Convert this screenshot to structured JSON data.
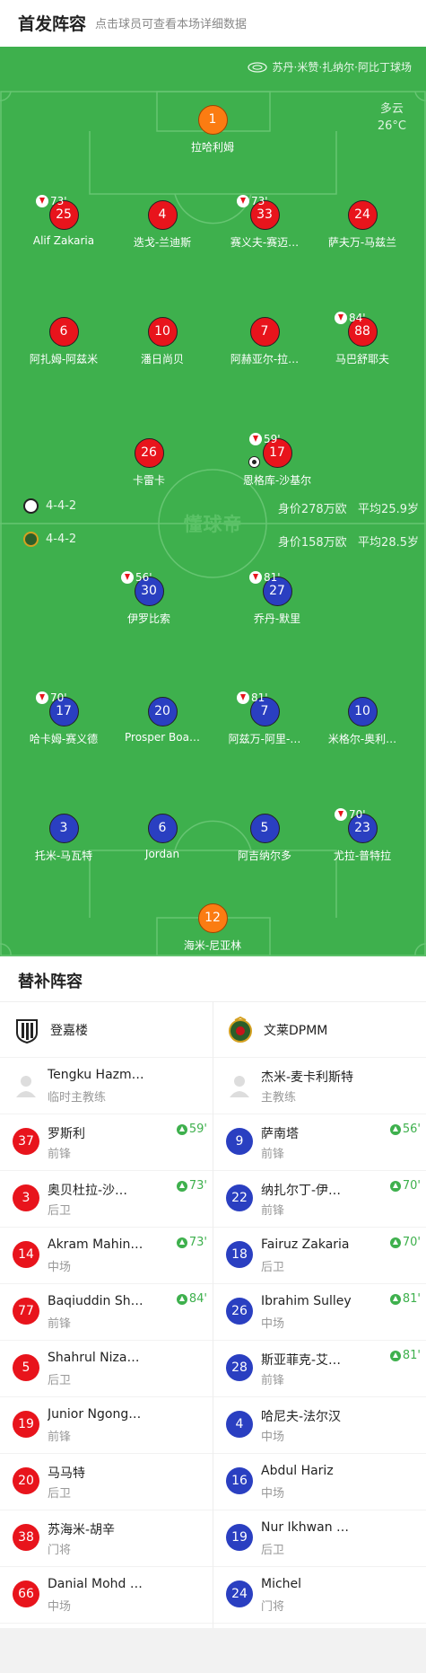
{
  "header": {
    "title": "首发阵容",
    "subtitle": "点击球员可查看本场详细数据"
  },
  "pitch": {
    "venue": "苏丹·米赞·扎纳尔·阿比丁球场",
    "weather": {
      "condition": "多云",
      "temperature": "26°C"
    },
    "watermark": "懂球帝",
    "home_formation": "4-4-2",
    "away_formation": "4-4-2",
    "home_value": "身价278万欧",
    "home_age": "平均25.9岁",
    "away_value": "身价158万欧",
    "away_age": "平均28.5岁",
    "home_players": [
      {
        "number": "1",
        "name": "拉哈利姆",
        "gk": true
      },
      {
        "number": "25",
        "name": "Alif Zakaria",
        "sub": "73'"
      },
      {
        "number": "4",
        "name": "迭戈-兰迪斯"
      },
      {
        "number": "33",
        "name": "赛义夫-赛迈…",
        "sub": "73'"
      },
      {
        "number": "24",
        "name": "萨夫万-马兹兰"
      },
      {
        "number": "6",
        "name": "阿扎姆-阿兹米"
      },
      {
        "number": "10",
        "name": "潘日尚贝"
      },
      {
        "number": "7",
        "name": "阿赫亚尔-拉…"
      },
      {
        "number": "88",
        "name": "马巴舒耶夫",
        "sub": "84'"
      },
      {
        "number": "26",
        "name": "卡雷卡"
      },
      {
        "number": "17",
        "name": "恩格库-沙基尔",
        "sub": "59'",
        "goal": true
      }
    ],
    "away_players": [
      {
        "number": "30",
        "name": "伊罗比索",
        "sub": "56'"
      },
      {
        "number": "27",
        "name": "乔丹-默里",
        "sub": "81'"
      },
      {
        "number": "17",
        "name": "哈卡姆-赛义德",
        "sub": "70'"
      },
      {
        "number": "20",
        "name": "Prosper Boa…"
      },
      {
        "number": "7",
        "name": "阿兹万-阿里-…",
        "sub": "81'"
      },
      {
        "number": "10",
        "name": "米格尔-奥利…"
      },
      {
        "number": "3",
        "name": "托米-马瓦特"
      },
      {
        "number": "6",
        "name": "Jordan"
      },
      {
        "number": "5",
        "name": "阿吉纳尔多"
      },
      {
        "number": "23",
        "name": "尤拉-普特拉",
        "sub": "70'"
      },
      {
        "number": "12",
        "name": "海米-尼亚林",
        "gk": true
      }
    ]
  },
  "subs": {
    "title": "替补阵容",
    "home": {
      "team": "登嘉楼",
      "coach": {
        "name": "Tengku Hazman",
        "role": "临时主教练"
      },
      "players": [
        {
          "number": "37",
          "name": "罗斯利",
          "pos": "前锋",
          "time": "59'"
        },
        {
          "number": "3",
          "name": "奥贝杜拉-沙…",
          "pos": "后卫",
          "time": "73'"
        },
        {
          "number": "14",
          "name": "Akram Mahinan",
          "pos": "中场",
          "time": "73'"
        },
        {
          "number": "77",
          "name": "Baqiuddin Sh…",
          "pos": "前锋",
          "time": "84'"
        },
        {
          "number": "5",
          "name": "Shahrul Niza…",
          "pos": "后卫"
        },
        {
          "number": "19",
          "name": "Junior Ngong …",
          "pos": "前锋"
        },
        {
          "number": "20",
          "name": "马马特",
          "pos": "后卫"
        },
        {
          "number": "38",
          "name": "苏海米-胡辛",
          "pos": "门将"
        },
        {
          "number": "66",
          "name": "Danial Mohd …",
          "pos": "中场"
        }
      ]
    },
    "away": {
      "team": "文莱DPMM",
      "coach": {
        "name": "杰米-麦卡利斯特",
        "role": "主教练"
      },
      "players": [
        {
          "number": "9",
          "name": "萨南塔",
          "pos": "前锋",
          "time": "56'"
        },
        {
          "number": "22",
          "name": "纳扎尔丁-伊…",
          "pos": "前锋",
          "time": "70'"
        },
        {
          "number": "18",
          "name": "Fairuz Zakaria",
          "pos": "后卫",
          "time": "70'"
        },
        {
          "number": "26",
          "name": "Ibrahim Sulley",
          "pos": "中场",
          "time": "81'"
        },
        {
          "number": "28",
          "name": "斯亚菲克-艾…",
          "pos": "前锋",
          "time": "81'"
        },
        {
          "number": "4",
          "name": "哈尼夫-法尔汉",
          "pos": "中场"
        },
        {
          "number": "16",
          "name": "Abdul Hariz",
          "pos": "中场"
        },
        {
          "number": "19",
          "name": "Nur Ikhwan O…",
          "pos": "后卫"
        },
        {
          "number": "24",
          "name": "Michel",
          "pos": "门将"
        }
      ]
    }
  },
  "colors": {
    "pitch": "#3eb04d",
    "home": "#e8141c",
    "away": "#2a3fc1",
    "goalkeeper": "#fb7c12"
  }
}
